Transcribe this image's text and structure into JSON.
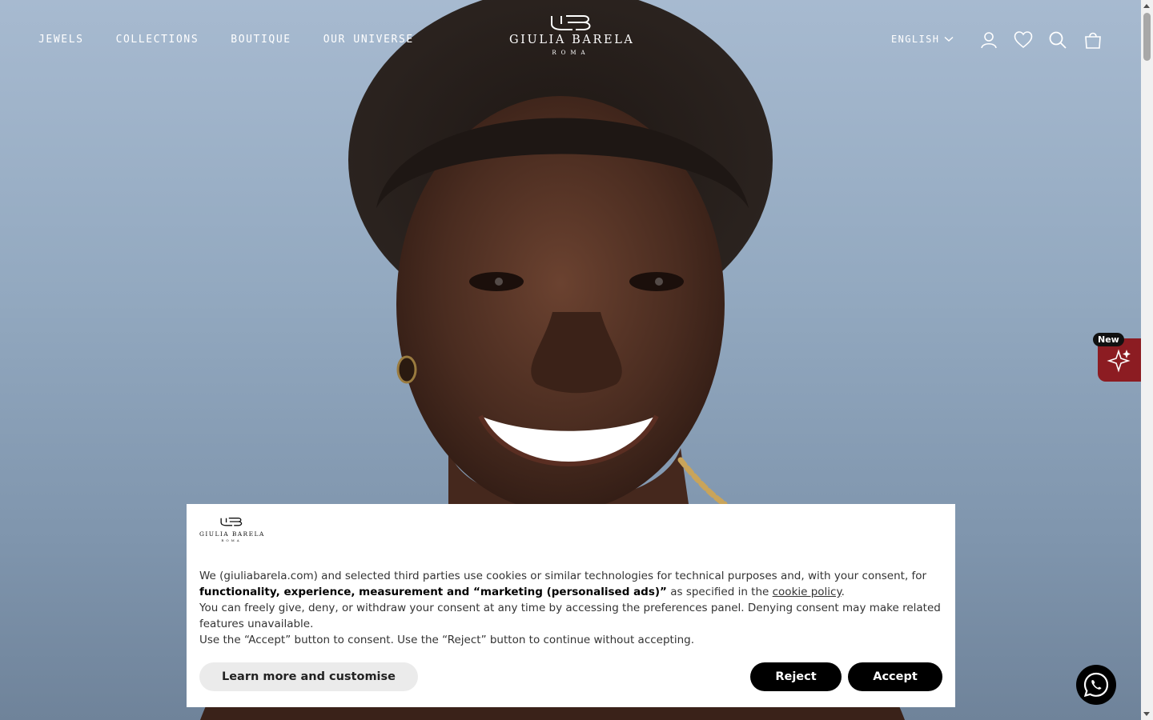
{
  "brand": {
    "name": "GIULIA BARELA",
    "city": "ROMA"
  },
  "nav": [
    {
      "label": "JEWELS"
    },
    {
      "label": "COLLECTIONS"
    },
    {
      "label": "BOUTIQUE"
    },
    {
      "label": "OUR UNIVERSE"
    }
  ],
  "header": {
    "language": "ENGLISH",
    "icons": [
      "account-icon",
      "wishlist-heart-icon",
      "search-icon",
      "cart-bag-icon"
    ]
  },
  "widget": {
    "badge": "New",
    "icon": "sparkle-icon"
  },
  "whatsapp": {
    "icon": "whatsapp-icon"
  },
  "cookie": {
    "line1_a": "We (giuliabarela.com) and selected third parties use cookies or similar technologies for technical purposes and, with your consent,",
    "line2_a": "for",
    "line2_bold": "functionality, experience, measurement and “marketing (personalised ads)”",
    "line2_b": "as specified in the",
    "line2_link": "cookie policy",
    "line2_end": ".",
    "line3": "You can freely give, deny, or withdraw your consent at any time by accessing the preferences panel. Denying consent may make related features unavailable.",
    "line4": "Use the “Accept” button to consent. Use the “Reject” button to continue without accepting.",
    "learn_label": "Learn more and customise",
    "reject_label": "Reject",
    "accept_label": "Accept"
  },
  "colors": {
    "banner_bg": "#ffffff",
    "button_dark": "#000000",
    "button_light": "#ebebeb",
    "widget_red": "#8c1c22"
  }
}
